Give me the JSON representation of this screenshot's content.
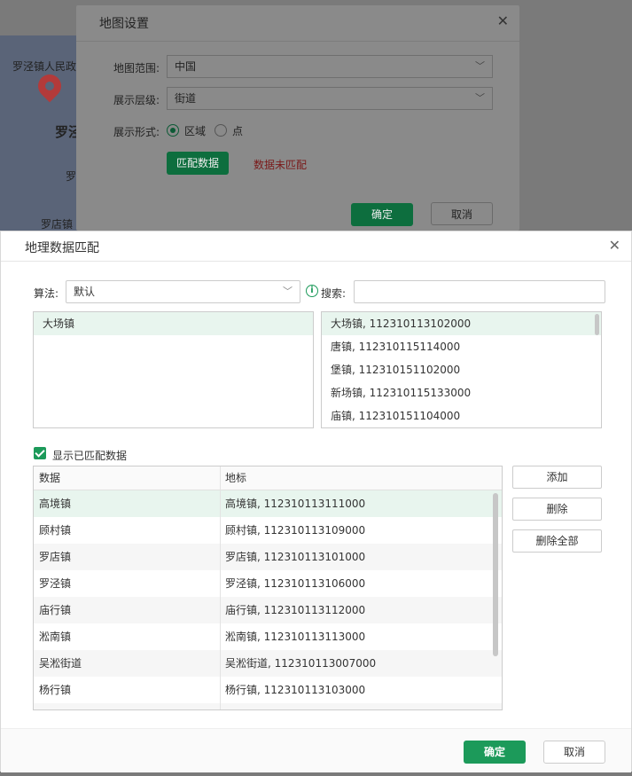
{
  "map": {
    "labels": [
      "罗泾镇人民政",
      "罗泾",
      "罗",
      "罗店镇"
    ]
  },
  "map_settings": {
    "title": "地图设置",
    "scope_label": "地图范围:",
    "scope_value": "中国",
    "level_label": "展示层级:",
    "level_value": "街道",
    "form_label": "展示形式:",
    "form_option_region": "区域",
    "form_option_point": "点",
    "match_button": "匹配数据",
    "match_status": "数据未匹配",
    "ok": "确定",
    "cancel": "取消"
  },
  "geo_match": {
    "title": "地理数据匹配",
    "algorithm_label": "算法:",
    "algorithm_value": "默认",
    "search_label": "搜索:",
    "search_value": "",
    "left_list": [
      "大场镇"
    ],
    "right_list": [
      "大场镇, 112310113102000",
      "唐镇, 112310115114000",
      "堡镇, 112310151102000",
      "新场镇, 112310115133000",
      "庙镇, 112310151104000"
    ],
    "show_matched_label": "显示已匹配数据",
    "table": {
      "columns": [
        "数据",
        "地标"
      ],
      "rows": [
        {
          "data": "高境镇",
          "landmark": "高境镇, 112310113111000"
        },
        {
          "data": "顾村镇",
          "landmark": "顾村镇, 112310113109000"
        },
        {
          "data": "罗店镇",
          "landmark": "罗店镇, 112310113101000"
        },
        {
          "data": "罗泾镇",
          "landmark": "罗泾镇, 112310113106000"
        },
        {
          "data": "庙行镇",
          "landmark": "庙行镇, 112310113112000"
        },
        {
          "data": "淞南镇",
          "landmark": "淞南镇, 112310113113000"
        },
        {
          "data": "吴淞街道",
          "landmark": "吴淞街道, 112310113007000"
        },
        {
          "data": "杨行镇",
          "landmark": "杨行镇, 112310113103000"
        }
      ]
    },
    "add_button": "添加",
    "delete_button": "删除",
    "delete_all_button": "删除全部",
    "ok": "确定",
    "cancel": "取消"
  }
}
